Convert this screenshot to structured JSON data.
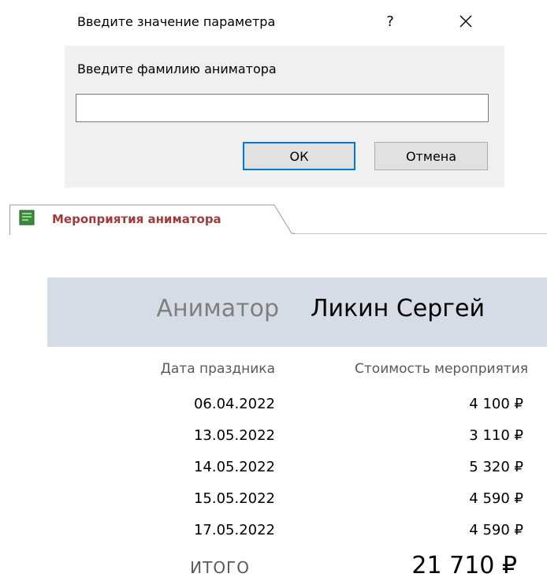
{
  "dialog": {
    "title": "Введите значение параметра",
    "help_label": "?",
    "prompt": "Введите фамилию аниматора",
    "input_value": "",
    "ok_label": "ОК",
    "cancel_label": "Отмена"
  },
  "tab": {
    "label": "Мероприятия аниматора",
    "icon": "report-icon"
  },
  "report": {
    "animator_label": "Аниматор",
    "animator_name": "Ликин Сергей",
    "columns": {
      "date": "Дата праздника",
      "cost": "Стоимость мероприятия"
    },
    "rows": [
      {
        "date": "06.04.2022",
        "cost": "4 100 ₽"
      },
      {
        "date": "13.05.2022",
        "cost": "3 110 ₽"
      },
      {
        "date": "14.05.2022",
        "cost": "5 320 ₽"
      },
      {
        "date": "15.05.2022",
        "cost": "4 590 ₽"
      },
      {
        "date": "17.05.2022",
        "cost": "4 590 ₽"
      }
    ],
    "total_label": "ИТОГО",
    "total_value": "21 710 ₽"
  },
  "colors": {
    "accent_focus": "#0078d7",
    "tab_label": "#a33a3a",
    "header_band": "#d6dce5",
    "dialog_body": "#f0f0f0"
  }
}
